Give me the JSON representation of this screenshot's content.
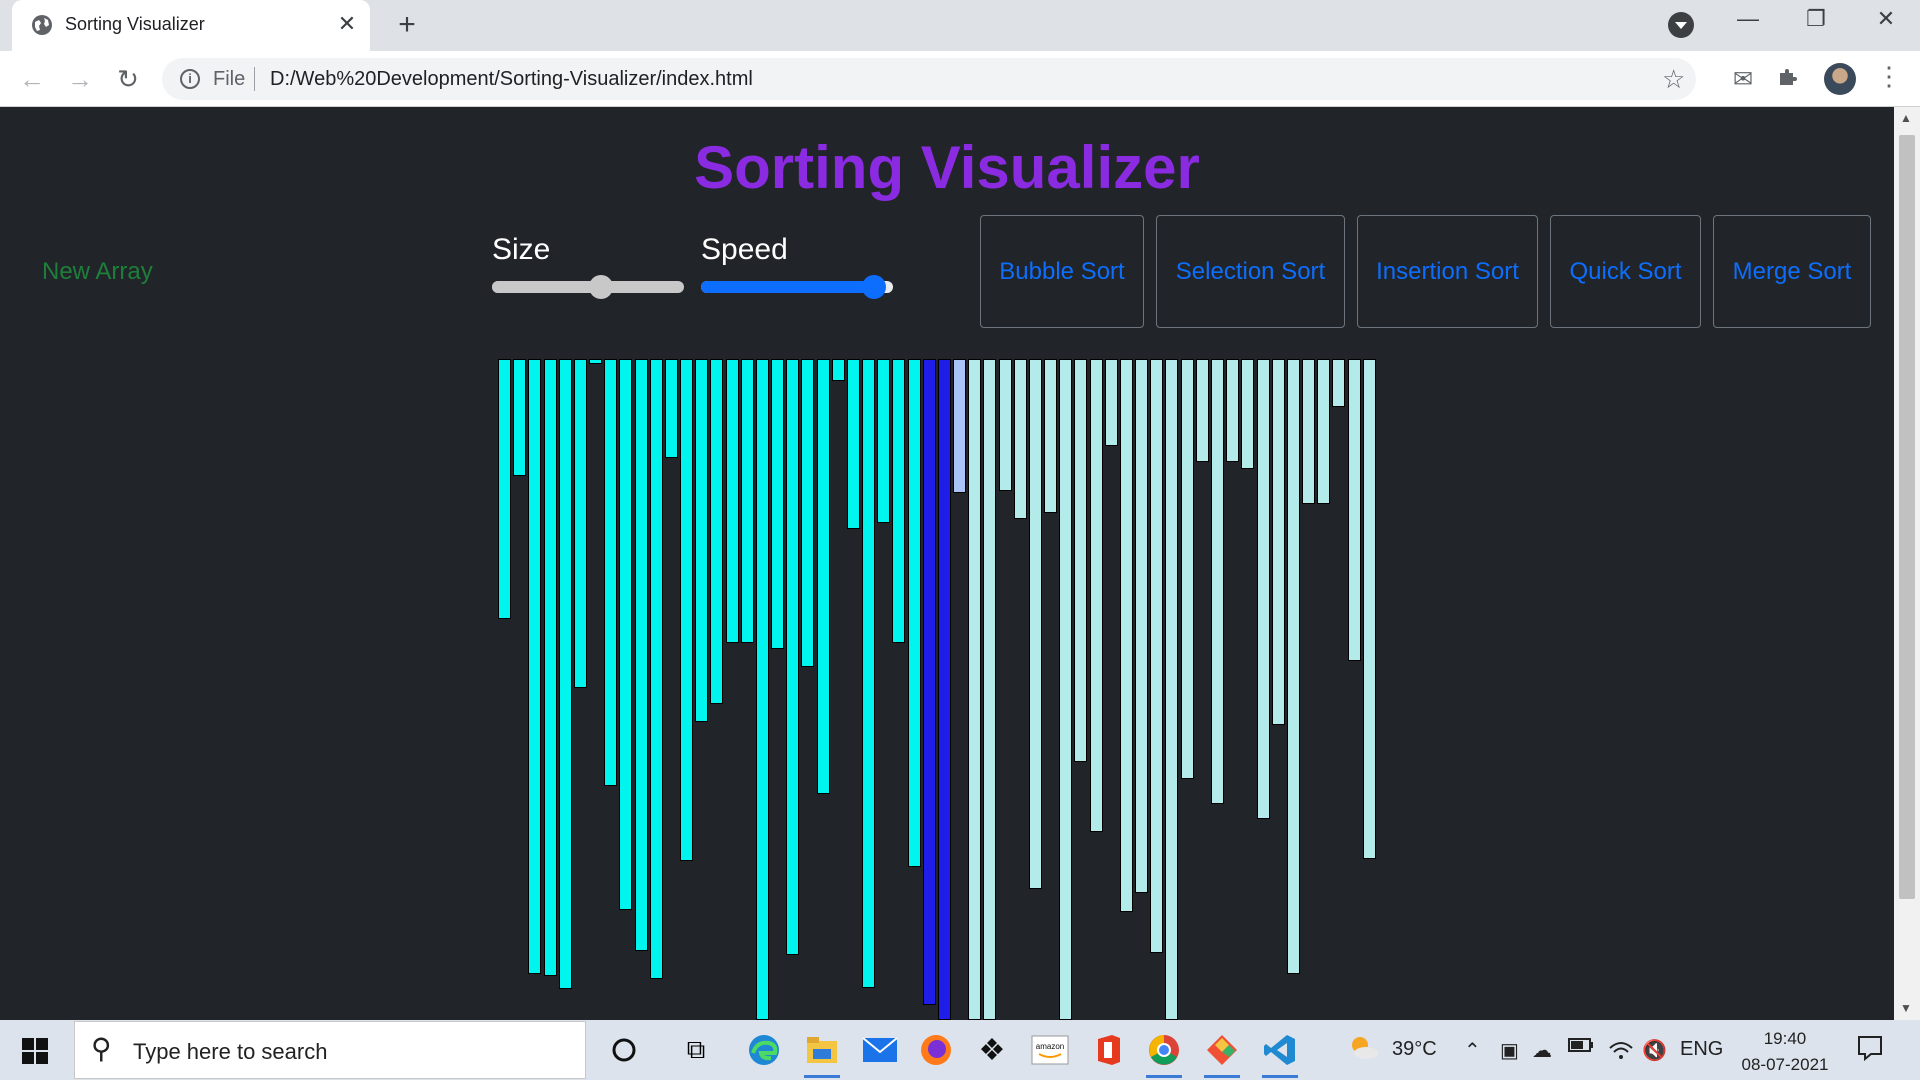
{
  "browser": {
    "tab_title": "Sorting Visualizer",
    "close_glyph": "✕",
    "new_tab_glyph": "+",
    "window_controls": [
      "—",
      "❐",
      "✕"
    ],
    "scheme_label": "File",
    "url": "D:/Web%20Development/Sorting-Visualizer/index.html",
    "icons": {
      "favicon": "globe-icon",
      "back": "←",
      "forward": "→",
      "reload": "↻",
      "info": "i",
      "star": "☆",
      "mail": "✉",
      "extensions": "puzzle-icon",
      "menu": "⋮"
    }
  },
  "page": {
    "heading": "Sorting Visualizer",
    "new_array_label": "New Array",
    "size_label": "Size",
    "speed_label": "Speed",
    "size_value": 0.57,
    "speed_value": 0.9,
    "algorithms": [
      "Bubble Sort",
      "Selection Sort",
      "Insertion Sort",
      "Quick Sort",
      "Merge Sort"
    ],
    "colors": {
      "background": "#212529",
      "heading": "#8a2be2",
      "new_array": "#1e7e3a",
      "buttons": "#0d6efd",
      "bar_unsorted": "#00f5ee",
      "bar_compare": "#1e1ee8",
      "bar_pivot": "#a9c4f5",
      "bar_sorted": "#b2ebea"
    },
    "bars": [
      {
        "value": 260,
        "state": "unsorted"
      },
      {
        "value": 117,
        "state": "unsorted"
      },
      {
        "value": 615,
        "state": "unsorted"
      },
      {
        "value": 617,
        "state": "unsorted"
      },
      {
        "value": 630,
        "state": "unsorted"
      },
      {
        "value": 329,
        "state": "unsorted"
      },
      {
        "value": 5,
        "state": "unsorted"
      },
      {
        "value": 427,
        "state": "unsorted"
      },
      {
        "value": 551,
        "state": "unsorted"
      },
      {
        "value": 592,
        "state": "unsorted"
      },
      {
        "value": 620,
        "state": "unsorted"
      },
      {
        "value": 99,
        "state": "unsorted"
      },
      {
        "value": 502,
        "state": "unsorted"
      },
      {
        "value": 363,
        "state": "unsorted"
      },
      {
        "value": 345,
        "state": "unsorted"
      },
      {
        "value": 284,
        "state": "unsorted"
      },
      {
        "value": 284,
        "state": "unsorted"
      },
      {
        "value": 661,
        "state": "unsorted"
      },
      {
        "value": 290,
        "state": "unsorted"
      },
      {
        "value": 596,
        "state": "unsorted"
      },
      {
        "value": 308,
        "state": "unsorted"
      },
      {
        "value": 435,
        "state": "unsorted"
      },
      {
        "value": 22,
        "state": "unsorted"
      },
      {
        "value": 170,
        "state": "unsorted"
      },
      {
        "value": 629,
        "state": "unsorted"
      },
      {
        "value": 164,
        "state": "unsorted"
      },
      {
        "value": 284,
        "state": "unsorted"
      },
      {
        "value": 508,
        "state": "unsorted"
      },
      {
        "value": 646,
        "state": "compare"
      },
      {
        "value": 661,
        "state": "compare"
      },
      {
        "value": 134,
        "state": "pivot"
      },
      {
        "value": 661,
        "state": "sorted"
      },
      {
        "value": 661,
        "state": "sorted"
      },
      {
        "value": 132,
        "state": "sorted"
      },
      {
        "value": 160,
        "state": "sorted"
      },
      {
        "value": 530,
        "state": "sorted"
      },
      {
        "value": 154,
        "state": "sorted"
      },
      {
        "value": 661,
        "state": "sorted"
      },
      {
        "value": 403,
        "state": "sorted"
      },
      {
        "value": 473,
        "state": "sorted"
      },
      {
        "value": 87,
        "state": "sorted"
      },
      {
        "value": 553,
        "state": "sorted"
      },
      {
        "value": 534,
        "state": "sorted"
      },
      {
        "value": 594,
        "state": "sorted"
      },
      {
        "value": 661,
        "state": "sorted"
      },
      {
        "value": 420,
        "state": "sorted"
      },
      {
        "value": 103,
        "state": "sorted"
      },
      {
        "value": 445,
        "state": "sorted"
      },
      {
        "value": 103,
        "state": "sorted"
      },
      {
        "value": 110,
        "state": "sorted"
      },
      {
        "value": 460,
        "state": "sorted"
      },
      {
        "value": 366,
        "state": "sorted"
      },
      {
        "value": 615,
        "state": "sorted"
      },
      {
        "value": 145,
        "state": "sorted"
      },
      {
        "value": 145,
        "state": "sorted"
      },
      {
        "value": 48,
        "state": "sorted"
      },
      {
        "value": 302,
        "state": "sorted"
      },
      {
        "value": 500,
        "state": "sorted"
      }
    ]
  },
  "taskbar": {
    "search_placeholder": "Type here to search",
    "weather": "39°C",
    "language": "ENG",
    "time": "19:40",
    "date": "08-07-2021"
  }
}
